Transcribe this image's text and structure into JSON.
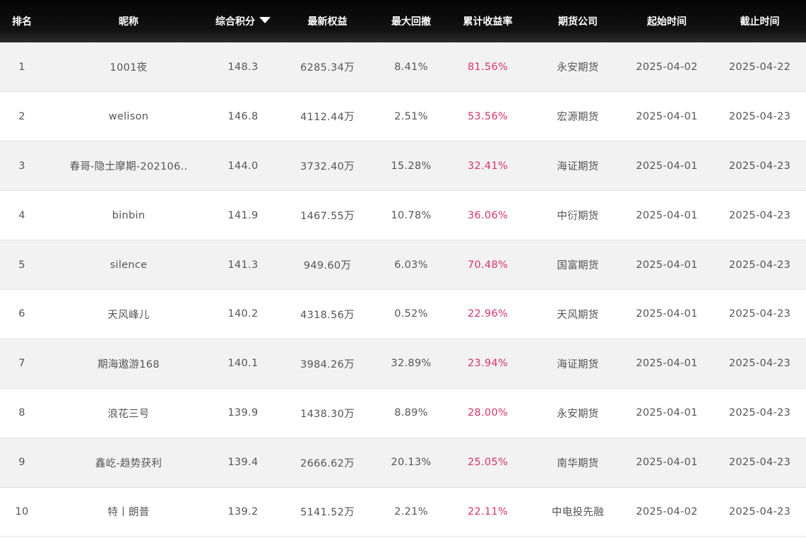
{
  "headers": {
    "rank": "排名",
    "nickname": "昵称",
    "score": "综合积分",
    "equity": "最新权益",
    "drawdown": "最大回撤",
    "return": "累计收益率",
    "company": "期货公司",
    "start": "起始时间",
    "end": "截止时间"
  },
  "sort_icon": "caret-down-icon",
  "colors": {
    "header_bg": "#0a0a0a",
    "return_text": "#d6336c",
    "row_alt": "#f2f2f2"
  },
  "rows": [
    {
      "rank": "1",
      "nickname": "1001夜",
      "score": "148.3",
      "equity": "6285.34万",
      "drawdown": "8.41%",
      "return": "81.56%",
      "company": "永安期货",
      "start": "2025-04-02",
      "end": "2025-04-22"
    },
    {
      "rank": "2",
      "nickname": "welison",
      "score": "146.8",
      "equity": "4112.44万",
      "drawdown": "2.51%",
      "return": "53.56%",
      "company": "宏源期货",
      "start": "2025-04-01",
      "end": "2025-04-23"
    },
    {
      "rank": "3",
      "nickname": "春哥-隐士摩期-202106..",
      "score": "144.0",
      "equity": "3732.40万",
      "drawdown": "15.28%",
      "return": "32.41%",
      "company": "海证期货",
      "start": "2025-04-01",
      "end": "2025-04-23"
    },
    {
      "rank": "4",
      "nickname": "binbin",
      "score": "141.9",
      "equity": "1467.55万",
      "drawdown": "10.78%",
      "return": "36.06%",
      "company": "中衍期货",
      "start": "2025-04-01",
      "end": "2025-04-23"
    },
    {
      "rank": "5",
      "nickname": "silence",
      "score": "141.3",
      "equity": "949.60万",
      "drawdown": "6.03%",
      "return": "70.48%",
      "company": "国富期货",
      "start": "2025-04-01",
      "end": "2025-04-23"
    },
    {
      "rank": "6",
      "nickname": "天风峰儿",
      "score": "140.2",
      "equity": "4318.56万",
      "drawdown": "0.52%",
      "return": "22.96%",
      "company": "天风期货",
      "start": "2025-04-01",
      "end": "2025-04-23"
    },
    {
      "rank": "7",
      "nickname": "期海遨游168",
      "score": "140.1",
      "equity": "3984.26万",
      "drawdown": "32.89%",
      "return": "23.94%",
      "company": "海证期货",
      "start": "2025-04-01",
      "end": "2025-04-23"
    },
    {
      "rank": "8",
      "nickname": "浪花三号",
      "score": "139.9",
      "equity": "1438.30万",
      "drawdown": "8.89%",
      "return": "28.00%",
      "company": "永安期货",
      "start": "2025-04-01",
      "end": "2025-04-23"
    },
    {
      "rank": "9",
      "nickname": "鑫屹-趋势获利",
      "score": "139.4",
      "equity": "2666.62万",
      "drawdown": "20.13%",
      "return": "25.05%",
      "company": "南华期货",
      "start": "2025-04-01",
      "end": "2025-04-23"
    },
    {
      "rank": "10",
      "nickname": "特丨朗普",
      "score": "139.2",
      "equity": "5141.52万",
      "drawdown": "2.21%",
      "return": "22.11%",
      "company": "中电投先融",
      "start": "2025-04-02",
      "end": "2025-04-23"
    }
  ]
}
